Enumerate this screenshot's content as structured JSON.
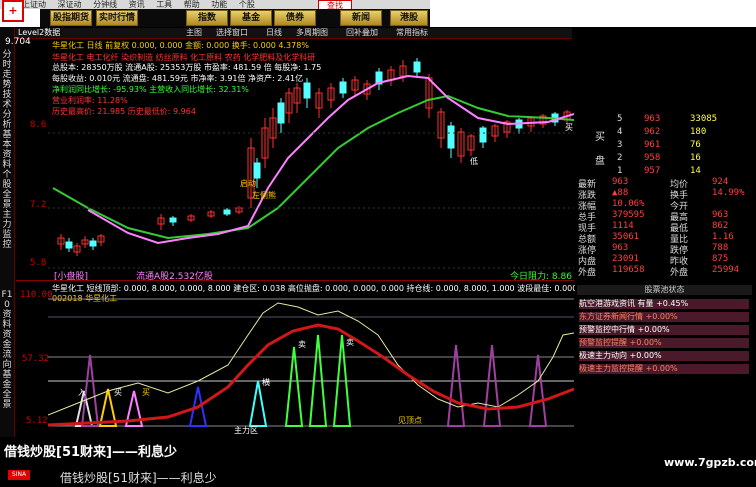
{
  "menu": {
    "items": [
      "上证动",
      "深证动",
      "分钟线",
      "资讯",
      "工具",
      "帮助",
      "功能",
      "个股"
    ],
    "search_label": "查找"
  },
  "toolbar": {
    "buttons": [
      "股指期货",
      "实时行情",
      "指数",
      "基金",
      "债券",
      "新闻",
      "港股"
    ]
  },
  "upper_toolbar": {
    "level2": "Level2数据",
    "items": [
      "主图",
      "选择窗口",
      "日线",
      "多周期图",
      "回补叠加",
      "常用指标"
    ]
  },
  "left_tabs": [
    "分时走势",
    "技术分析",
    "基本资料",
    "个股全景",
    "主力监控",
    "F10资料",
    "资金流向",
    "基金全景",
    "F5对比",
    "F10分析"
  ],
  "stock": {
    "name_code": "华星化工",
    "price_top": "9.704",
    "header_line": "华星化工 日线  前复权  0.000, 0.000  金额: 0.000  换手: 0.000  4.378%",
    "info_lines": [
      "华星化工  电工化纤 染织制造 纺丝原料 化工原料 农药 化学肥料及化学科研",
      "总股本: 28350万股   流通A股: 25353万股   市盈率: 481.59 倍   每股净: 1.75",
      "每股收益: 0.010元   流通盘: 481.59元   市净率: 3.91倍   净资产: 2.41亿",
      "净利润同比增长: -95.93%   主营收入同比增长: 32.31%",
      "营业利润率: 11.28%",
      "历史最高价: 21.985        历史最低价: 9.964"
    ],
    "tags": [
      "[小盘股]",
      "流通A股2.532亿股",
      "今日阻力: 8.86"
    ],
    "annotations": [
      "卖出",
      "左侧熊",
      "启动",
      "低",
      "买"
    ]
  },
  "axis": {
    "upper": [
      "8.6",
      "7.2",
      "5.8"
    ],
    "lower": [
      "110.00",
      "57.32",
      "5.12"
    ]
  },
  "lower_panel": {
    "header_line1": "华星化工  短线顶部: 0.000, 8.000, 0.000, 8.000  建仓区: 0.038  高位抛盘: 0.000, 0.000, 0.000  持仓线: 0.000, 8.000, 1.000  波段最佳: 0.000",
    "header_line2": "002018 华星化工",
    "labels": [
      "入",
      "买",
      "买",
      "横",
      "卖",
      "卖",
      "主力区",
      "见顶点"
    ]
  },
  "quote": {
    "sell": [
      {
        "level": "5",
        "price": "963",
        "vol": "33085"
      },
      {
        "level": "4",
        "price": "962",
        "vol": "180"
      },
      {
        "level": "3",
        "price": "961",
        "vol": "76"
      },
      {
        "level": "2",
        "price": "958",
        "vol": "16"
      },
      {
        "level": "1",
        "price": "957",
        "vol": "14"
      }
    ],
    "side_labels": [
      "买",
      "盘"
    ],
    "stats": [
      {
        "k": "最新",
        "v": "963",
        "k2": "均价",
        "v2": "924"
      },
      {
        "k": "涨跌",
        "v": "▲88",
        "k2": "换手",
        "v2": "14.99%"
      },
      {
        "k": "涨幅",
        "v": "10.06%",
        "k2": "今开",
        "v2": ""
      },
      {
        "k": "总手",
        "v": "379595",
        "k2": "最高",
        "v2": "963"
      },
      {
        "k": "现手",
        "v": "1114",
        "k2": "最低",
        "v2": "862"
      },
      {
        "k": "总额",
        "v": "35061",
        "k2": "量比",
        "v2": "1.16"
      },
      {
        "k": "涨停",
        "v": "963",
        "k2": "跌停",
        "v2": "788"
      },
      {
        "k": "内盘",
        "v": "23091",
        "k2": "昨收",
        "v2": "875"
      },
      {
        "k": "外盘",
        "v": "119658",
        "k2": "外盘",
        "v2": "25994"
      }
    ],
    "alert_title": "股票池状态",
    "alerts": [
      "航空港游戏资讯 有量 +0.45%",
      "东方证券新闻行情 +0.00%",
      "预警监控中行情 +0.00%",
      "预警监控提醒 +0.00%",
      "极速主力动向 +0.00%",
      "极速主力监控提醒 +0.00%"
    ]
  },
  "bottom": {
    "slogan1": "借钱炒股[51财来]——利息少",
    "slogan2": "借钱炒股[51财来]——利息少",
    "watermark": "www.7gpzb.com",
    "sina": "SINA"
  },
  "colors": {
    "accent_red": "#d00000",
    "up_red": "#ff3030",
    "down_cyan": "#54ffff",
    "ma_green": "#33cc33",
    "ma_pink": "#ff80ff",
    "gold": "#c8a030"
  }
}
